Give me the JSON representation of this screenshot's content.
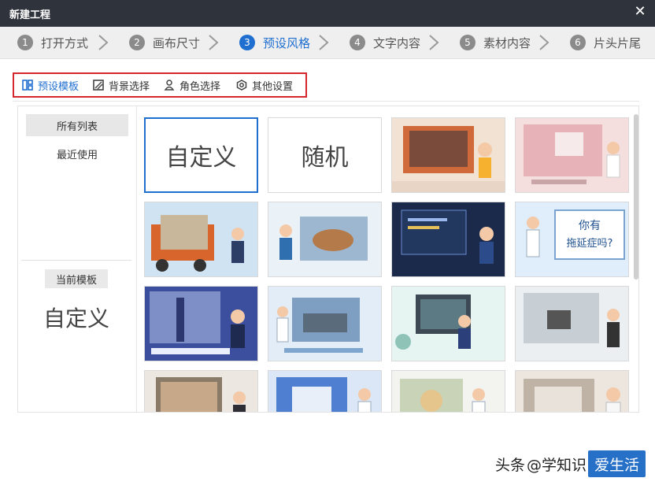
{
  "window": {
    "title": "新建工程"
  },
  "steps": [
    {
      "num": "1",
      "label": "打开方式"
    },
    {
      "num": "2",
      "label": "画布尺寸"
    },
    {
      "num": "3",
      "label": "预设风格"
    },
    {
      "num": "4",
      "label": "文字内容"
    },
    {
      "num": "5",
      "label": "素材内容"
    },
    {
      "num": "6",
      "label": "片头片尾"
    }
  ],
  "tabs": [
    {
      "label": "预设模板",
      "icon": "template-icon"
    },
    {
      "label": "背景选择",
      "icon": "background-icon"
    },
    {
      "label": "角色选择",
      "icon": "person-icon"
    },
    {
      "label": "其他设置",
      "icon": "settings-icon"
    }
  ],
  "left": {
    "all_list": "所有列表",
    "recent": "最近使用",
    "current_label": "当前模板",
    "current_value": "自定义"
  },
  "cards": {
    "custom": "自定义",
    "random": "随机",
    "thumb_texts": [
      "你有",
      "拖延症吗?"
    ]
  },
  "colors": {
    "accent": "#1f6fd0",
    "titlebar": "#2f343c",
    "highlight_box": "#d4262b"
  },
  "watermark": {
    "prefix": "头条",
    "handle_plain": "@学知识",
    "handle_highlight": "爱生活"
  }
}
